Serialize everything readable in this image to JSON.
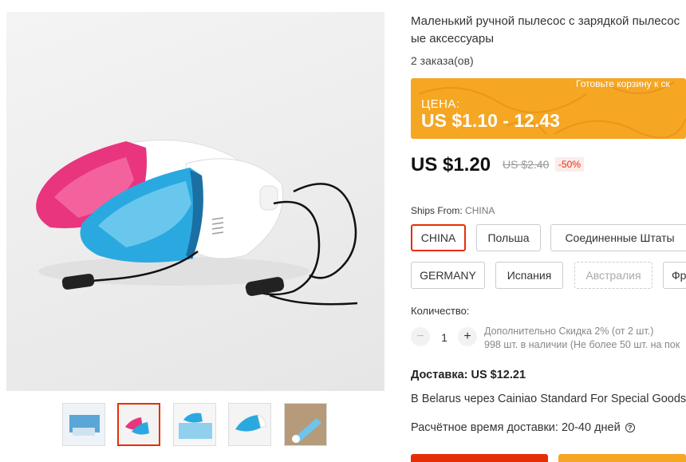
{
  "product": {
    "title_line1": "Маленький ручной пылесос с зарядкой пылесос",
    "title_line2": "ые аксессуары",
    "orders": "2 заказа(ов)"
  },
  "banner": {
    "promo_text": "Готовьте корзину к ск",
    "label": "ЦЕНА:",
    "price_range": "US $1.10 - 12.43"
  },
  "price": {
    "current": "US $1.20",
    "old": "US $2.40",
    "discount": "-50%"
  },
  "ships_from": {
    "label": "Ships From:",
    "selected": "CHINA",
    "options": [
      "CHINA",
      "Польша",
      "Соединенные Штаты",
      "GERMANY",
      "Испания",
      "Австралия",
      "Фр"
    ]
  },
  "quantity": {
    "label": "Количество:",
    "value": "1",
    "minus": "−",
    "plus": "+",
    "note_line1": "Дополнительно Скидка 2% (от 2 шт.)",
    "note_line2": "998 шт. в наличии (Не более 50 шт. на пок"
  },
  "delivery": {
    "title": "Доставка: US $12.21",
    "route": "В Belarus через Cainiao Standard For Special Goods",
    "time": "Расчётное время доставки: 20-40 дней",
    "help_icon_glyph": "?"
  },
  "gallery": {
    "selected_index": 1,
    "thumbnail_count": 5
  },
  "colors": {
    "accent": "#e62e04",
    "banner": "#f5a623"
  }
}
